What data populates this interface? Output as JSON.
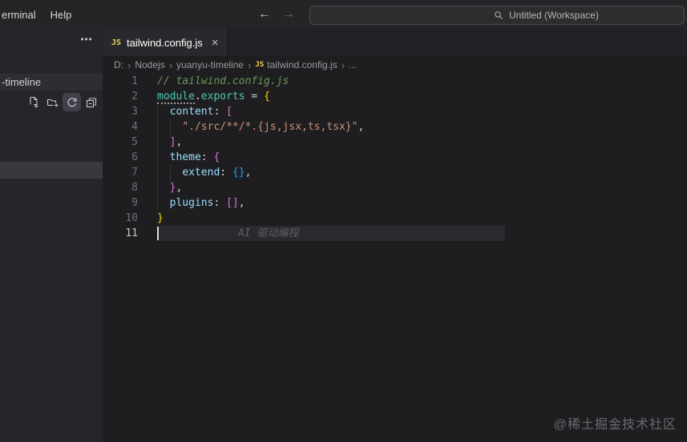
{
  "window": {
    "menu_items": [
      {
        "id": "terminal",
        "label": "erminal"
      },
      {
        "id": "help",
        "label": "Help"
      }
    ],
    "nav": {
      "back": "←",
      "forward": "→"
    },
    "command_center": {
      "text": "Untitled (Workspace)"
    }
  },
  "sidebar": {
    "more_actions": "⋯",
    "folder_label": "-timeline",
    "action_icons": [
      "new-file-icon",
      "new-folder-icon",
      "refresh-explorer-icon",
      "collapse-folders-icon"
    ]
  },
  "tabs": {
    "active": {
      "icon": "JS",
      "label": "tailwind.config.js",
      "close": "×"
    }
  },
  "breadcrumb": {
    "separator": "›",
    "items": [
      {
        "label": "D:"
      },
      {
        "label": "Nodejs"
      },
      {
        "label": "yuanyu-timeline"
      },
      {
        "label": "tailwind.config.js",
        "icon": "JS"
      },
      {
        "label": "..."
      }
    ]
  },
  "editor": {
    "language": "javascript",
    "ghost_text": "AI 驱动编程",
    "lines": [
      {
        "num": "1",
        "tokens": [
          {
            "c": "comment",
            "t": "// tailwind.config.js"
          }
        ]
      },
      {
        "num": "2",
        "tokens": [
          {
            "c": "teal hint",
            "t": "module"
          },
          {
            "c": "fg",
            "t": "."
          },
          {
            "c": "teal",
            "t": "exports"
          },
          {
            "c": "fg",
            "t": " = "
          },
          {
            "c": "gold",
            "t": "{"
          }
        ]
      },
      {
        "num": "3",
        "tokens": [
          {
            "c": "fg",
            "t": "  "
          },
          {
            "c": "prop",
            "t": "content"
          },
          {
            "c": "fg",
            "t": ": "
          },
          {
            "c": "orchid",
            "t": "["
          }
        ]
      },
      {
        "num": "4",
        "tokens": [
          {
            "c": "fg",
            "t": "    "
          },
          {
            "c": "string",
            "t": "\"./src/**/*.{js,jsx,ts,tsx}\""
          },
          {
            "c": "fg",
            "t": ","
          }
        ]
      },
      {
        "num": "5",
        "tokens": [
          {
            "c": "fg",
            "t": "  "
          },
          {
            "c": "orchid",
            "t": "]"
          },
          {
            "c": "fg",
            "t": ","
          }
        ]
      },
      {
        "num": "6",
        "tokens": [
          {
            "c": "fg",
            "t": "  "
          },
          {
            "c": "prop",
            "t": "theme"
          },
          {
            "c": "fg",
            "t": ": "
          },
          {
            "c": "orchid",
            "t": "{"
          }
        ]
      },
      {
        "num": "7",
        "tokens": [
          {
            "c": "fg",
            "t": "    "
          },
          {
            "c": "prop",
            "t": "extend"
          },
          {
            "c": "fg",
            "t": ": "
          },
          {
            "c": "blue",
            "t": "{}"
          },
          {
            "c": "fg",
            "t": ","
          }
        ]
      },
      {
        "num": "8",
        "tokens": [
          {
            "c": "fg",
            "t": "  "
          },
          {
            "c": "orchid",
            "t": "}"
          },
          {
            "c": "fg",
            "t": ","
          }
        ]
      },
      {
        "num": "9",
        "tokens": [
          {
            "c": "fg",
            "t": "  "
          },
          {
            "c": "prop",
            "t": "plugins"
          },
          {
            "c": "fg",
            "t": ": "
          },
          {
            "c": "orchid",
            "t": "[]"
          },
          {
            "c": "fg",
            "t": ","
          }
        ]
      },
      {
        "num": "10",
        "tokens": [
          {
            "c": "gold",
            "t": "}"
          }
        ]
      },
      {
        "num": "11",
        "active": true,
        "tokens": []
      }
    ]
  },
  "watermark": "@稀土掘金技术社区",
  "colors": {
    "titlebar": "#252528",
    "sidebar": "#26262a",
    "editor": "#1e1e21",
    "active_tab": "#29292d",
    "js_icon": "#e8d44d",
    "comment": "#6a9955",
    "property": "#9cdcfe",
    "string": "#ce9178",
    "teal": "#4ec9b0",
    "bracket_level1": "#ffd700",
    "bracket_level2": "#da70d6",
    "bracket_level3": "#179fff",
    "selection_row": "#38383e"
  }
}
